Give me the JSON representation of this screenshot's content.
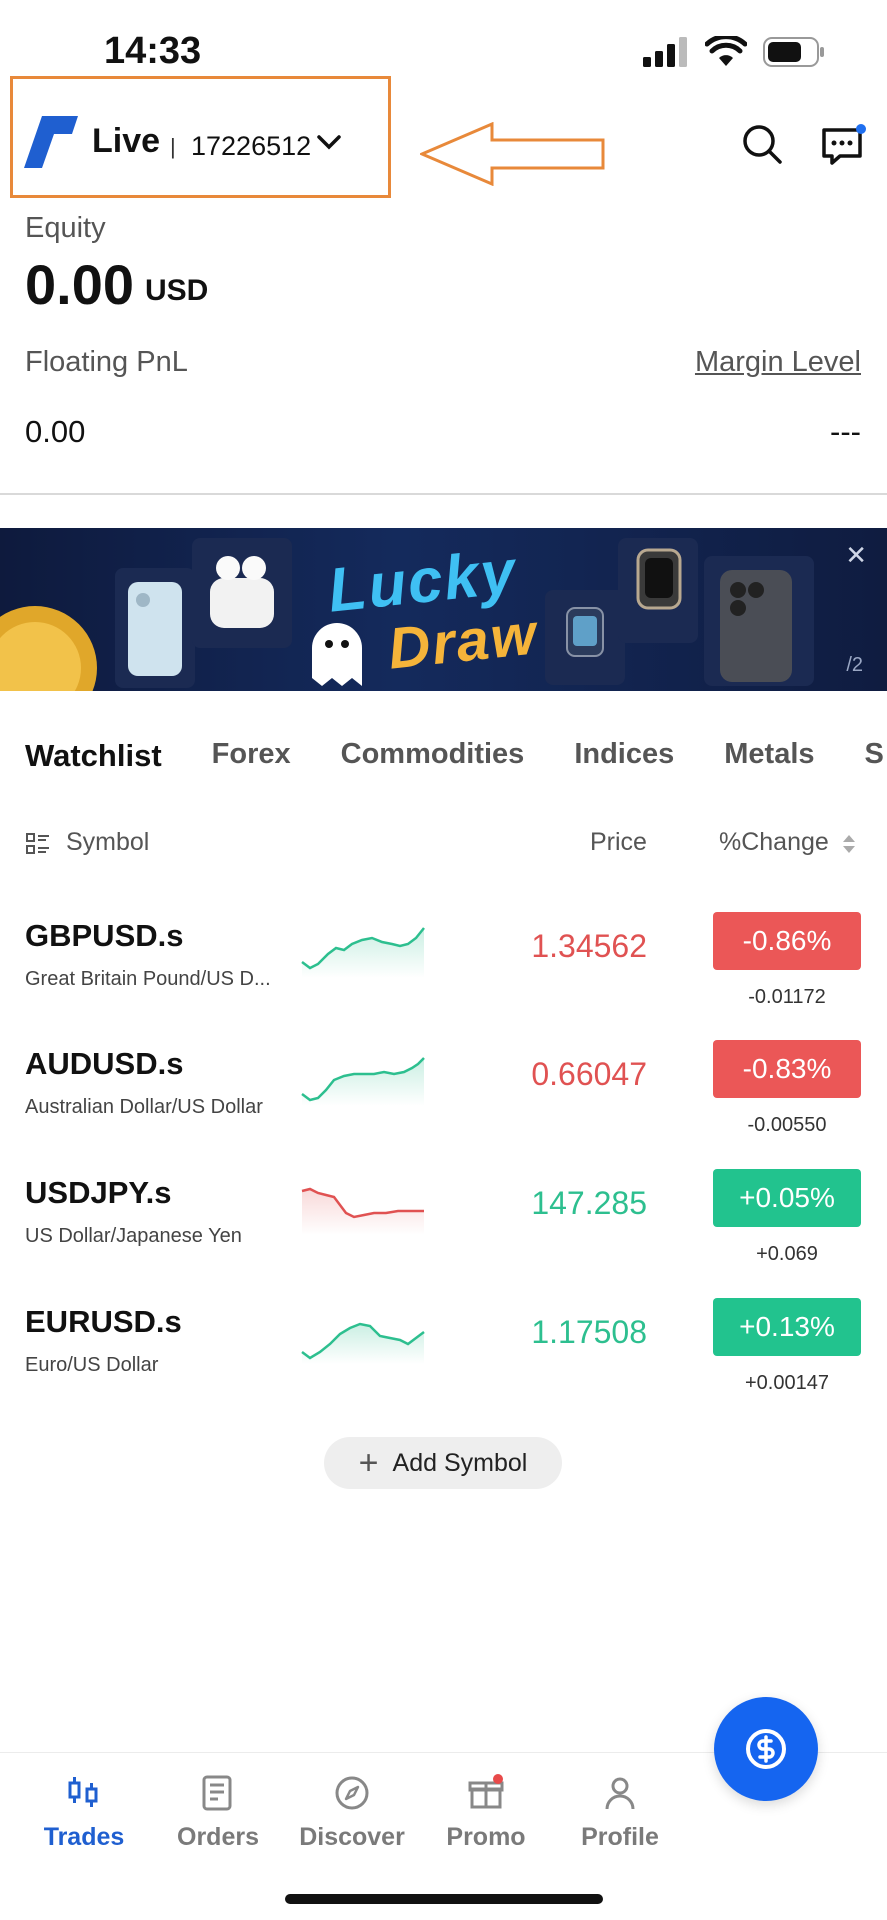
{
  "status_bar": {
    "time": "14:33"
  },
  "header": {
    "account_type": "Live",
    "separator": "|",
    "account_number": "17226512"
  },
  "equity": {
    "label": "Equity",
    "value": "0.00",
    "currency": "USD",
    "floating_pnl_label": "Floating PnL",
    "floating_pnl_value": "0.00",
    "margin_level_label": "Margin Level",
    "margin_level_value": "---"
  },
  "banner": {
    "title_line1": "Lucky",
    "title_line2": "Draw",
    "page_indicator": "/2",
    "close": "✕"
  },
  "tabs": [
    {
      "label": "Watchlist",
      "active": true
    },
    {
      "label": "Forex"
    },
    {
      "label": "Commodities"
    },
    {
      "label": "Indices"
    },
    {
      "label": "Metals"
    },
    {
      "label": "S"
    }
  ],
  "list_header": {
    "symbol": "Symbol",
    "price": "Price",
    "change": "%Change"
  },
  "watchlist": [
    {
      "symbol": "GBPUSD.s",
      "desc": "Great Britain Pound/US D...",
      "price": "1.34562",
      "change_pct": "-0.86%",
      "change_abs": "-0.01172",
      "direction": "down"
    },
    {
      "symbol": "AUDUSD.s",
      "desc": "Australian Dollar/US Dollar",
      "price": "0.66047",
      "change_pct": "-0.83%",
      "change_abs": "-0.00550",
      "direction": "down"
    },
    {
      "symbol": "USDJPY.s",
      "desc": "US Dollar/Japanese Yen",
      "price": "147.285",
      "change_pct": "+0.05%",
      "change_abs": "+0.069",
      "direction": "up"
    },
    {
      "symbol": "EURUSD.s",
      "desc": "Euro/US Dollar",
      "price": "1.17508",
      "change_pct": "+0.13%",
      "change_abs": "+0.00147",
      "direction": "up"
    }
  ],
  "add_symbol": {
    "label": "Add Symbol"
  },
  "nav": [
    {
      "label": "Trades",
      "icon": "trades-icon",
      "active": true
    },
    {
      "label": "Orders",
      "icon": "orders-icon"
    },
    {
      "label": "Discover",
      "icon": "compass-icon"
    },
    {
      "label": "Promo",
      "icon": "gift-icon"
    },
    {
      "label": "Profile",
      "icon": "profile-icon"
    }
  ],
  "colors": {
    "accent": "#1565f0",
    "negative": "#eb5757",
    "positive": "#22c38e",
    "highlight": "#e8893a"
  }
}
